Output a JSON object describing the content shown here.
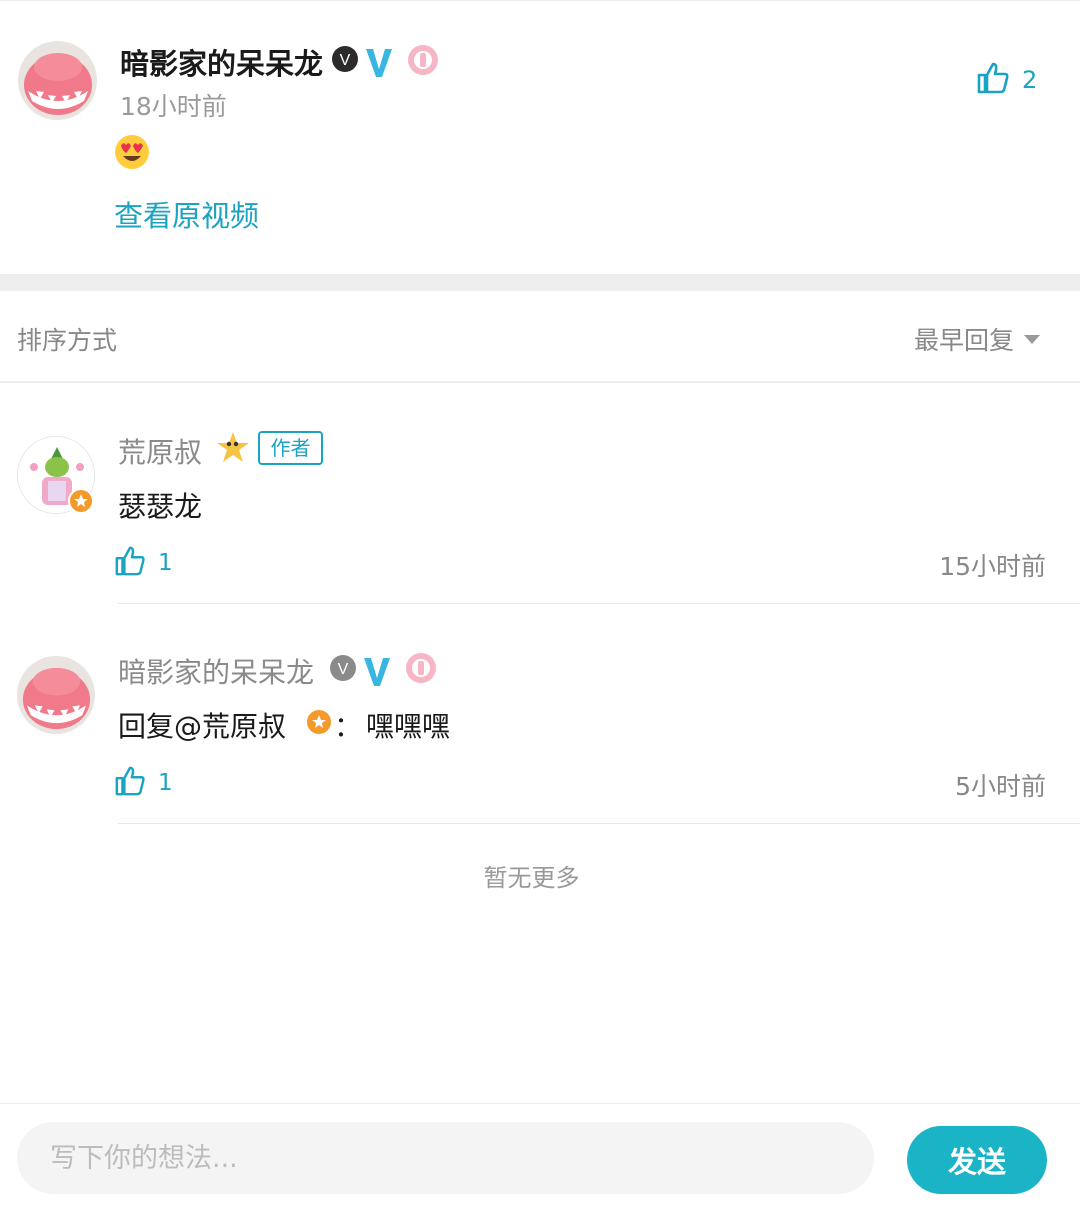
{
  "top_comment": {
    "author": "暗影家的呆呆龙",
    "time": "18小时前",
    "emoji": "😍",
    "view_video_label": "查看原视频",
    "like_count": "2"
  },
  "sort": {
    "label": "排序方式",
    "value": "最早回复"
  },
  "replies": [
    {
      "author": "荒原叔",
      "tag": "作者",
      "text": "瑟瑟龙",
      "like_count": "1",
      "time": "15小时前"
    },
    {
      "author": "暗影家的呆呆龙",
      "reply_prefix": "回复@荒原叔",
      "reply_sep": "：",
      "reply_text": "嘿嘿嘿",
      "like_count": "1",
      "time": "5小时前"
    }
  ],
  "no_more_text": "暂无更多",
  "input": {
    "placeholder": "写下你的想法..."
  },
  "send_label": "发送",
  "colors": {
    "accent": "#1aa3c2",
    "send_button": "#1bb3c6",
    "badge_orange": "#f39a2b",
    "verified_blue": "#39b6e0"
  }
}
